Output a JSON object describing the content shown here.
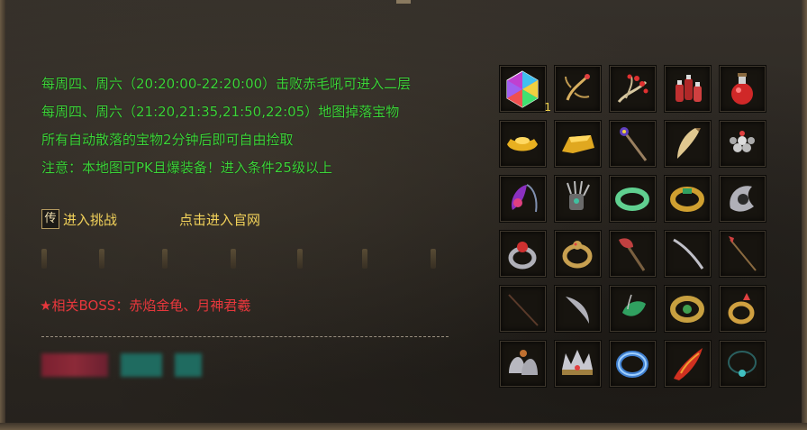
{
  "info_lines": [
    "每周四、周六（20:20:00-22:20:00）击败赤毛吼可进入二层",
    "每周四、周六（21:20,21:35,21:50,22:05）地图掉落宝物",
    "所有自动散落的宝物2分钟后即可自由捡取",
    "注意：本地图可PK且爆装备！进入条件25级以上"
  ],
  "actions": {
    "badge": "传",
    "enter_challenge": "进入挑战",
    "official_site": "点击进入官网"
  },
  "boss": {
    "star": "★",
    "text": "相关BOSS：赤焰金龟、月神君羲"
  },
  "items": [
    {
      "icon": "rainbow-gem-icon",
      "count": "1"
    },
    {
      "icon": "golden-root-icon"
    },
    {
      "icon": "red-berry-root-icon"
    },
    {
      "icon": "potion-bottles-icon"
    },
    {
      "icon": "red-potion-icon"
    },
    {
      "icon": "gold-ingot-icon"
    },
    {
      "icon": "gold-bar-icon"
    },
    {
      "icon": "jeweled-staff-icon"
    },
    {
      "icon": "beast-tooth-icon"
    },
    {
      "icon": "pearl-bracelet-icon"
    },
    {
      "icon": "purple-amulet-icon"
    },
    {
      "icon": "claw-gauntlet-icon"
    },
    {
      "icon": "jade-bangle-icon"
    },
    {
      "icon": "emerald-gold-ring-icon"
    },
    {
      "icon": "silver-wing-ring-icon"
    },
    {
      "icon": "ruby-ring-icon"
    },
    {
      "icon": "dragon-ring-icon"
    },
    {
      "icon": "battle-axe-icon"
    },
    {
      "icon": "curved-blade-icon"
    },
    {
      "icon": "spear-icon"
    },
    {
      "icon": "dark-staff-icon"
    },
    {
      "icon": "crescent-blade-icon"
    },
    {
      "icon": "jade-leaf-pendant-icon"
    },
    {
      "icon": "dragon-bracer-icon"
    },
    {
      "icon": "crowned-ring-icon"
    },
    {
      "icon": "silver-bells-icon"
    },
    {
      "icon": "spiked-crown-icon"
    },
    {
      "icon": "ice-ring-icon"
    },
    {
      "icon": "flame-wing-icon"
    },
    {
      "icon": "teal-necklace-icon"
    }
  ]
}
